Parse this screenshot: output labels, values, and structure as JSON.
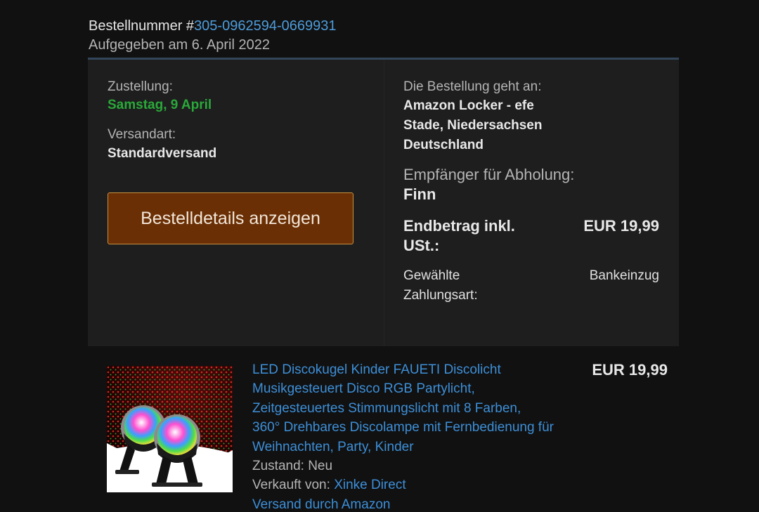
{
  "order": {
    "number_label": "Bestellnummer #",
    "number": "305-0962594-0669931",
    "placed": "Aufgegeben am 6. April 2022"
  },
  "delivery": {
    "label": "Zustellung:",
    "date": "Samstag, 9 April",
    "shipping_label": "Versandart:",
    "shipping_value": "Standardversand"
  },
  "details_button": "Bestelldetails anzeigen",
  "recipient": {
    "label": "Die Bestellung geht an:",
    "line1": "Amazon Locker - efe",
    "line2": "Stade, Niedersachsen",
    "line3": "Deutschland",
    "pickup_label": "Empfänger für Abholung:",
    "pickup_name": "Finn"
  },
  "totals": {
    "total_label": "Endbetrag inkl. USt.:",
    "total_value": "EUR 19,99",
    "payment_label": "Gewählte Zahlungsart:",
    "payment_value": "Bankeinzug"
  },
  "product": {
    "title_lines": [
      "LED Discokugel Kinder FAUETI Discolicht",
      "Musikgesteuert Disco RGB Partylicht,",
      "Zeitgesteuertes Stimmungslicht mit 8 Farben,",
      "360° Drehbares Discolampe mit Fernbedienung für",
      "Weihnachten, Party, Kinder"
    ],
    "condition": "Zustand: Neu",
    "sold_by_label": "Verkauft von: ",
    "seller": "Xinke Direct",
    "fulfilled": "Versand durch Amazon",
    "price": "EUR 19,99"
  },
  "colors": {
    "link": "#3d8fd8",
    "delivery_green": "#2aa83a",
    "button_bg": "#6a2f05",
    "button_border": "#c9913f",
    "card_bg": "#1e1e1e",
    "page_bg": "#111111"
  }
}
